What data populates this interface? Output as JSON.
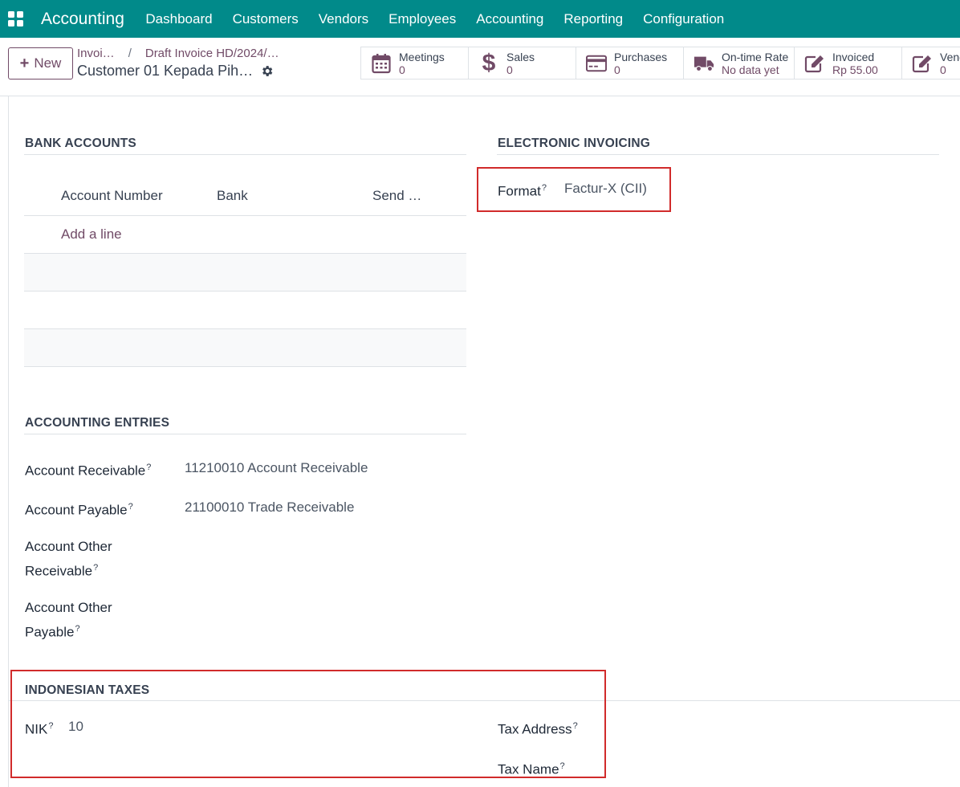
{
  "colors": {
    "brand": "#018a8a",
    "accent": "#714b67",
    "highlight_box": "#d12b2b"
  },
  "navbar": {
    "app_title": "Accounting",
    "items": [
      "Dashboard",
      "Customers",
      "Vendors",
      "Employees",
      "Accounting",
      "Reporting",
      "Configuration"
    ]
  },
  "control_panel": {
    "new_label": "New",
    "breadcrumb": {
      "first": "Invoi…",
      "separator": "/",
      "second": "Draft Invoice HD/2024/…"
    },
    "record_title": "Customer 01 Kepada Pih…",
    "smart_buttons": [
      {
        "label": "Meetings",
        "value": "0",
        "icon": "calendar-icon"
      },
      {
        "label": "Sales",
        "value": "0",
        "icon": "dollar-icon"
      },
      {
        "label": "Purchases",
        "value": "0",
        "icon": "credit-card-icon"
      },
      {
        "label": "On-time Rate",
        "value": "No data yet",
        "icon": "truck-icon"
      },
      {
        "label": "Invoiced",
        "value": "Rp 55.00",
        "icon": "pencil-square-icon"
      },
      {
        "label": "Vendor Bills",
        "value": "0",
        "icon": "pencil-square-icon"
      }
    ]
  },
  "bank_accounts": {
    "title": "BANK ACCOUNTS",
    "columns": [
      "Account Number",
      "Bank",
      "Send …"
    ],
    "add_line": "Add a line"
  },
  "electronic_invoicing": {
    "title": "ELECTRONIC INVOICING",
    "format_label": "Format",
    "format_value": "Factur-X (CII)"
  },
  "accounting_entries": {
    "title": "ACCOUNTING ENTRIES",
    "fields": [
      {
        "label": "Account Receivable",
        "value": "11210010 Account Receivable"
      },
      {
        "label": "Account Payable",
        "value": "21100010 Trade Receivable"
      },
      {
        "label_line1": "Account Other",
        "label_line2": "Receivable",
        "value": ""
      },
      {
        "label_line1": "Account Other",
        "label_line2": "Payable",
        "value": ""
      }
    ]
  },
  "indonesian_taxes": {
    "title": "INDONESIAN TAXES",
    "nik_label": "NIK",
    "nik_value": "10",
    "tax_address_label": "Tax Address",
    "tax_name_label": "Tax Name"
  },
  "help_marker": "?"
}
